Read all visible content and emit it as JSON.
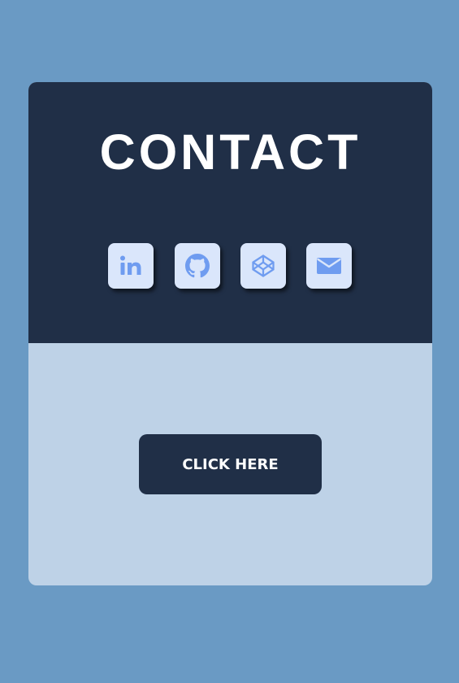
{
  "card": {
    "title": "CONTACT"
  },
  "socials": [
    {
      "icon": "linkedin-icon"
    },
    {
      "icon": "github-icon"
    },
    {
      "icon": "codepen-icon"
    },
    {
      "icon": "mail-icon"
    }
  ],
  "cta": {
    "label": "CLICK HERE"
  },
  "colors": {
    "page_background": "#6a9ac4",
    "card_top": "#202f47",
    "card_bottom": "#bed2e7",
    "icon_tile": "#dae6fb",
    "icon_glyph": "#6f9cf0",
    "button": "#202f47",
    "button_text": "#ffffff"
  }
}
